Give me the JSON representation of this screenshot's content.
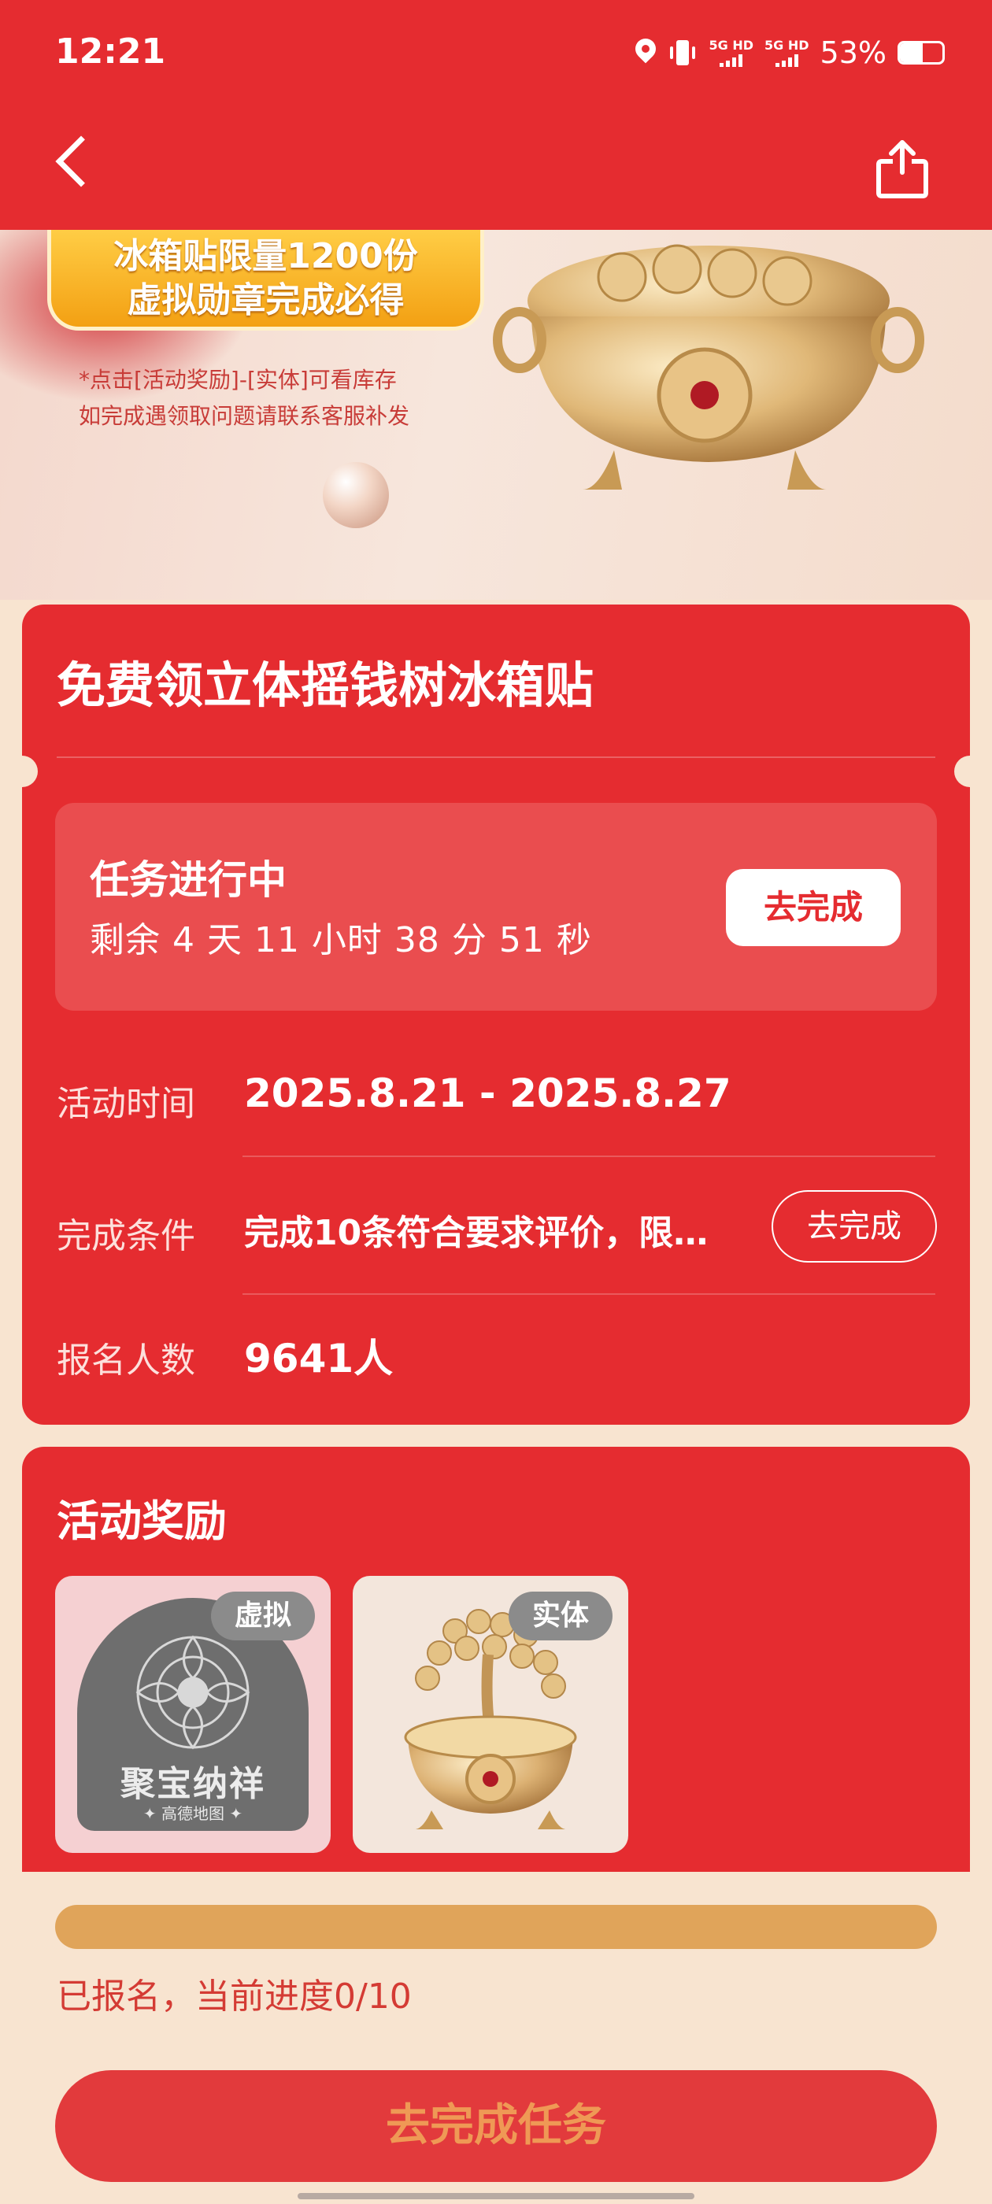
{
  "status_bar": {
    "time": "12:21",
    "net1": "5G HD",
    "net2": "5G HD",
    "battery_pct": "53%",
    "battery_level": 0.53
  },
  "nav": {
    "back_icon": "chevron-left-icon",
    "share_icon": "share-icon"
  },
  "banner": {
    "ribbon_line1": "冰箱贴限量1200份",
    "ribbon_line2": "虚拟勋章完成必得",
    "note_line1": "*点击[活动奖励]-[实体]可看库存",
    "note_line2": "如完成遇领取问题请联系客服补发"
  },
  "info": {
    "title": "免费领立体摇钱树冰箱贴",
    "status_title": "任务进行中",
    "countdown": "剩余 4 天 11 小时 38 分 51 秒",
    "status_button": "去完成",
    "time_label": "活动时间",
    "time_value": "2025.8.21 - 2025.8.27",
    "condition_label": "完成条件",
    "condition_value": "完成10条符合要求评价，限…",
    "condition_button": "去完成",
    "signup_label": "报名人数",
    "signup_value": "9641人"
  },
  "rewards": {
    "title": "活动奖励",
    "items": [
      {
        "tag": "虚拟",
        "medal_text": "聚宝纳祥",
        "medal_sub": "✦ 高德地图 ✦"
      },
      {
        "tag": "实体"
      }
    ]
  },
  "progress": {
    "current": 0,
    "total": 10,
    "text": "已报名，当前进度0/10"
  },
  "cta": {
    "label": "去完成任务"
  },
  "colors": {
    "primary_red": "#e52c30",
    "page_bg": "#f8e4d0",
    "progress_track": "#e0a45a",
    "cta_text": "#ef9955"
  }
}
